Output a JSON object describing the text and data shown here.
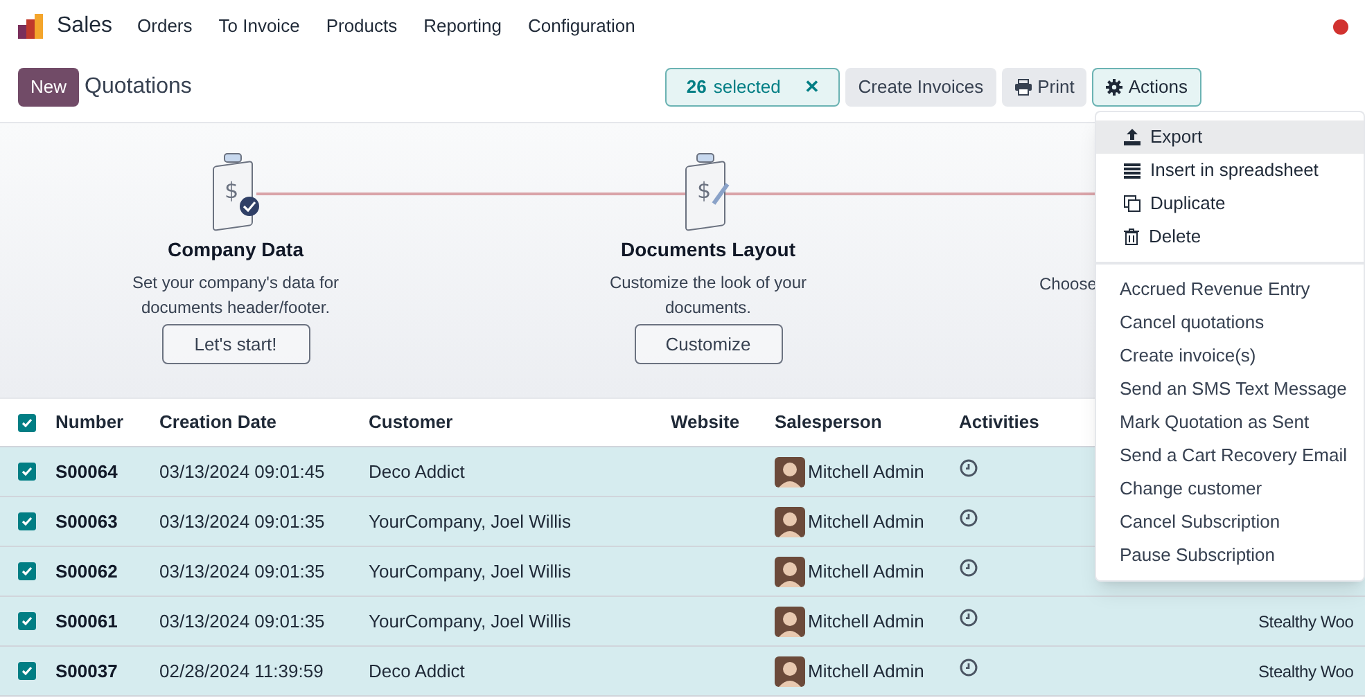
{
  "app": {
    "name": "Sales"
  },
  "menu": [
    "Orders",
    "To Invoice",
    "Products",
    "Reporting",
    "Configuration"
  ],
  "control_bar": {
    "new_button": "New",
    "title": "Quotations",
    "selection": {
      "count": "26",
      "label": "selected",
      "clear": "✕"
    },
    "buttons": [
      {
        "label": "Create Invoices",
        "kind": "plain"
      },
      {
        "label": "Print",
        "kind": "print"
      },
      {
        "label": "Actions",
        "kind": "actions",
        "expanded": true
      }
    ]
  },
  "onboarding": [
    {
      "symbol": "$",
      "title": "Company Data",
      "text": "Set your company's data for documents header/footer.",
      "button": "Let's start!",
      "done": true
    },
    {
      "symbol": "$",
      "title": "Documents Layout",
      "text": "Customize the look of your documents.",
      "button": "Customize",
      "done": false
    },
    {
      "text": "Choose"
    }
  ],
  "table": {
    "all_checked": true,
    "columns": [
      "Number",
      "Creation Date",
      "Customer",
      "Website",
      "Salesperson",
      "Activities"
    ],
    "rows": [
      {
        "selected": true,
        "number": "S00064",
        "date": "03/13/2024 09:01:45",
        "customer": "Deco Addict",
        "salesperson": "Mitchell Admin"
      },
      {
        "selected": true,
        "number": "S00063",
        "date": "03/13/2024 09:01:35",
        "customer": "YourCompany, Joel Willis",
        "salesperson": "Mitchell Admin"
      },
      {
        "selected": true,
        "number": "S00062",
        "date": "03/13/2024 09:01:35",
        "customer": "YourCompany, Joel Willis",
        "salesperson": "Mitchell Admin"
      },
      {
        "selected": true,
        "number": "S00061",
        "date": "03/13/2024 09:01:35",
        "customer": "YourCompany, Joel Willis",
        "salesperson": "Mitchell Admin",
        "column_8": "Stealthy Woo"
      },
      {
        "selected": true,
        "number": "S00037",
        "date": "02/28/2024 11:39:59",
        "customer": "Deco Addict",
        "salesperson": "Mitchell Admin",
        "column_8": "Stealthy Woo"
      }
    ]
  },
  "actions_menu": {
    "items": [
      {
        "label": "Export",
        "kind": "export",
        "selected": true
      },
      {
        "label": "Insert in spreadsheet",
        "kind": "spreadsheet",
        "selected": false
      },
      {
        "label": "Duplicate",
        "kind": "duplicate",
        "selected": false
      },
      {
        "label": "Delete",
        "kind": "delete",
        "selected": false
      },
      {
        "kind": "divider"
      },
      {
        "label": "Accrued Revenue Entry",
        "kind": "text",
        "selected": false
      },
      {
        "label": "Cancel quotations",
        "kind": "text",
        "selected": false
      },
      {
        "label": "Create invoice(s)",
        "kind": "text",
        "selected": false
      },
      {
        "label": "Send an SMS Text Message",
        "kind": "text",
        "selected": false
      },
      {
        "label": "Mark Quotation as Sent",
        "kind": "text",
        "selected": false
      },
      {
        "label": "Send a Cart Recovery Email",
        "kind": "text",
        "selected": false
      },
      {
        "label": "Change customer",
        "kind": "text",
        "selected": false
      },
      {
        "label": "Cancel Subscription",
        "kind": "text",
        "selected": false
      },
      {
        "label": "Pause Subscription",
        "kind": "text",
        "selected": false
      }
    ]
  }
}
